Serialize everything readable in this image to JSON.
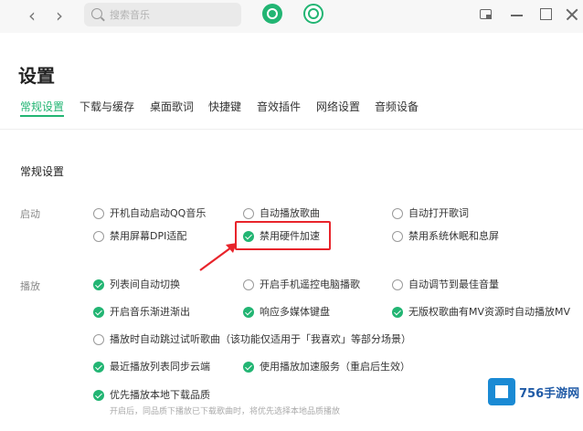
{
  "titlebar": {
    "back_glyph": "‹",
    "forward_glyph": "›",
    "search_placeholder": "搜索音乐"
  },
  "page": {
    "title": "设置"
  },
  "tabs": [
    {
      "label": "常规设置",
      "active": true
    },
    {
      "label": "下载与缓存",
      "active": false
    },
    {
      "label": "桌面歌词",
      "active": false
    },
    {
      "label": "快捷键",
      "active": false
    },
    {
      "label": "音效插件",
      "active": false
    },
    {
      "label": "网络设置",
      "active": false
    },
    {
      "label": "音频设备",
      "active": false
    }
  ],
  "section": {
    "title": "常规设置"
  },
  "groups": {
    "startup": {
      "label": "启动",
      "options": [
        {
          "label": "开机自动启动QQ音乐",
          "checked": false
        },
        {
          "label": "自动播放歌曲",
          "checked": false
        },
        {
          "label": "自动打开歌词",
          "checked": false
        },
        {
          "label": "禁用屏幕DPI适配",
          "checked": false
        },
        {
          "label": "禁用硬件加速",
          "checked": true
        },
        {
          "label": "禁用系统休眠和息屏",
          "checked": false
        }
      ]
    },
    "playback": {
      "label": "播放",
      "options": [
        {
          "label": "列表间自动切换",
          "checked": true
        },
        {
          "label": "开启手机遥控电脑播歌",
          "checked": false
        },
        {
          "label": "自动调节到最佳音量",
          "checked": false
        },
        {
          "label": "开启音乐渐进渐出",
          "checked": true
        },
        {
          "label": "响应多媒体键盘",
          "checked": true
        },
        {
          "label": "无版权歌曲有MV资源时自动播放MV",
          "checked": true
        },
        {
          "label": "播放时自动跳过试听歌曲（该功能仅适用于「我喜欢」等部分场景）",
          "checked": false
        },
        {
          "label": "最近播放列表同步云端",
          "checked": true
        },
        {
          "label": "使用播放加速服务（重启后生效）",
          "checked": true
        },
        {
          "label": "优先播放本地下载品质",
          "checked": true
        }
      ],
      "note": "开启后，同品质下播放已下载歌曲时，将优先选择本地品质播放"
    }
  },
  "watermark": {
    "text": "756手游网"
  },
  "colors": {
    "accent": "#22b573",
    "highlight": "#e8242b"
  }
}
